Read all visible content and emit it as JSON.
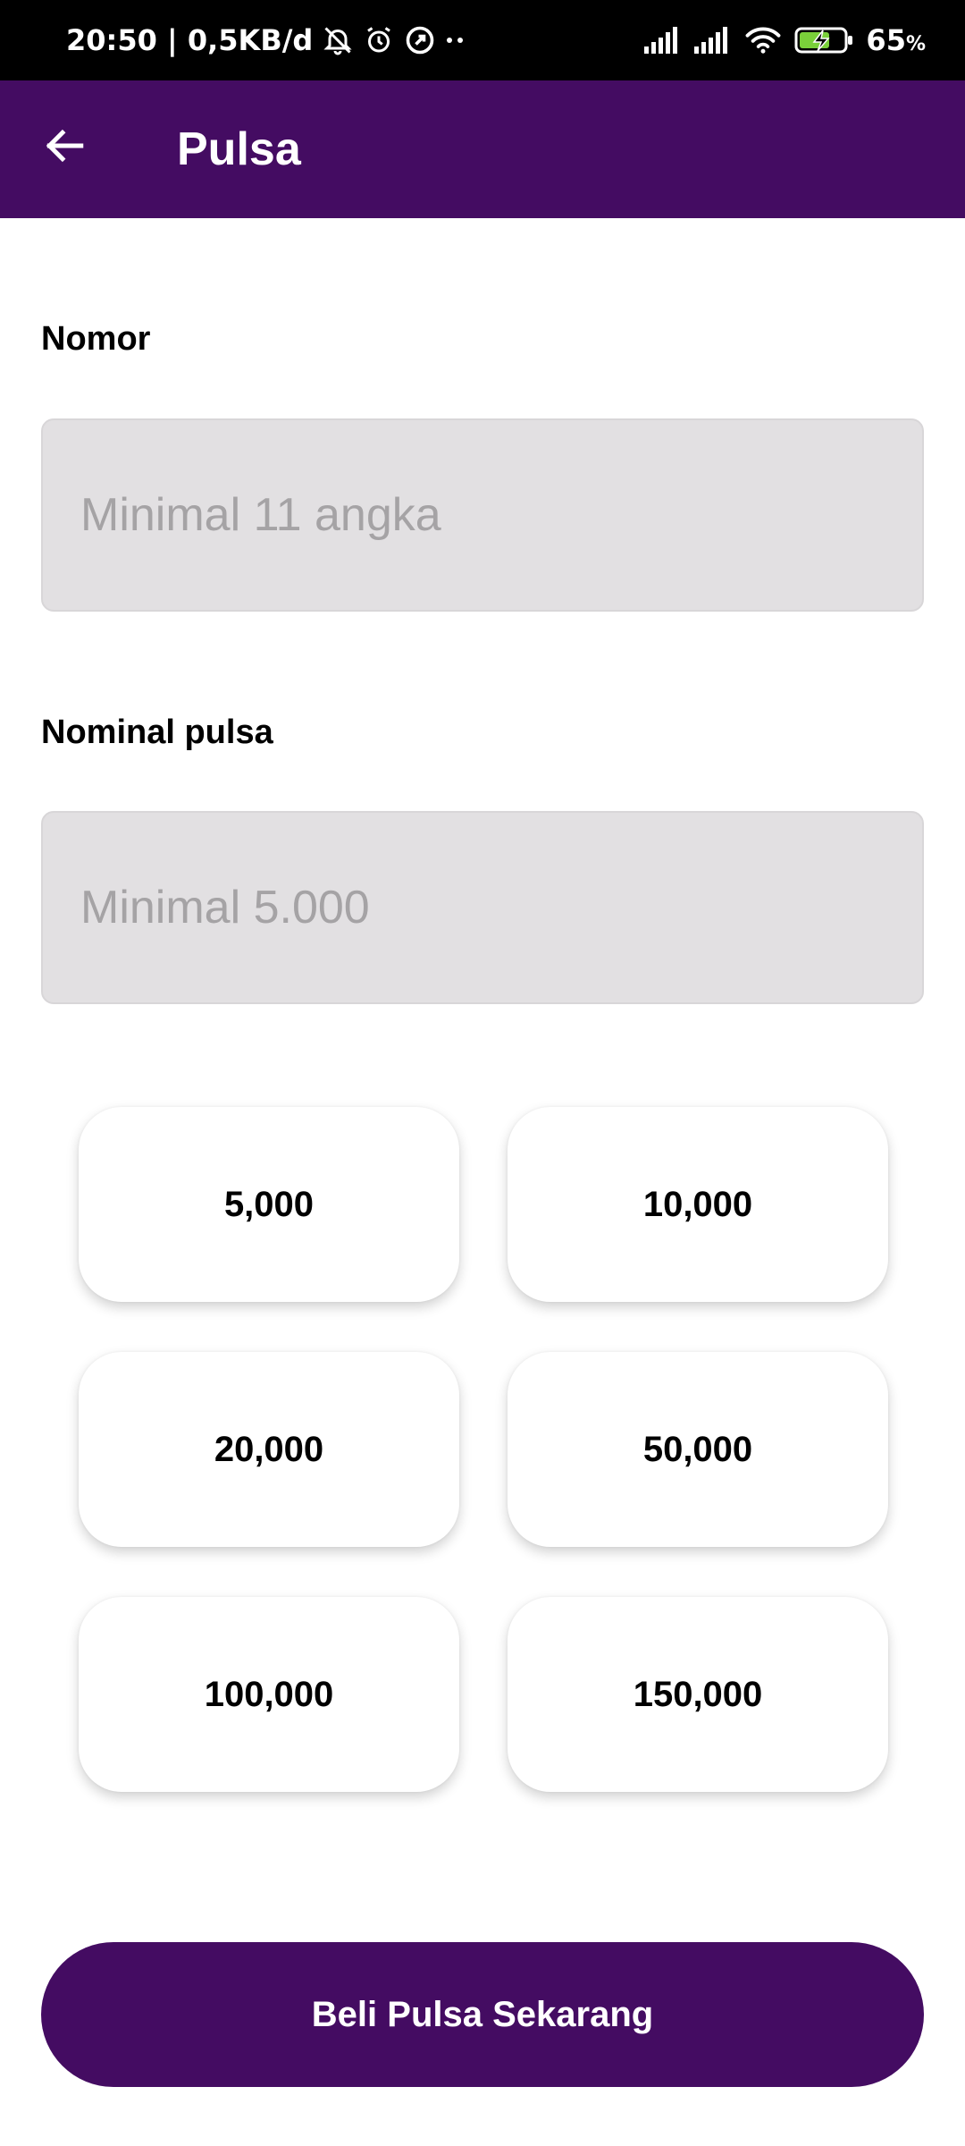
{
  "status_bar": {
    "time_info": "20:50 | 0,5KB/d",
    "battery_percent": "65",
    "battery_symbol": "%"
  },
  "app_bar": {
    "title": "Pulsa"
  },
  "form": {
    "number_label": "Nomor",
    "number_placeholder": "Minimal 11 angka",
    "number_value": "",
    "nominal_label": "Nominal pulsa",
    "nominal_placeholder": "Minimal 5.000",
    "nominal_value": ""
  },
  "nominal_options": [
    {
      "label": "5,000"
    },
    {
      "label": "10,000"
    },
    {
      "label": "20,000"
    },
    {
      "label": "50,000"
    },
    {
      "label": "100,000"
    },
    {
      "label": "150,000"
    }
  ],
  "buy_button": {
    "label": "Beli Pulsa Sekarang"
  },
  "colors": {
    "primary": "#440c62",
    "field_background": "#e2e0e2",
    "placeholder_text": "#a5a3a5"
  }
}
